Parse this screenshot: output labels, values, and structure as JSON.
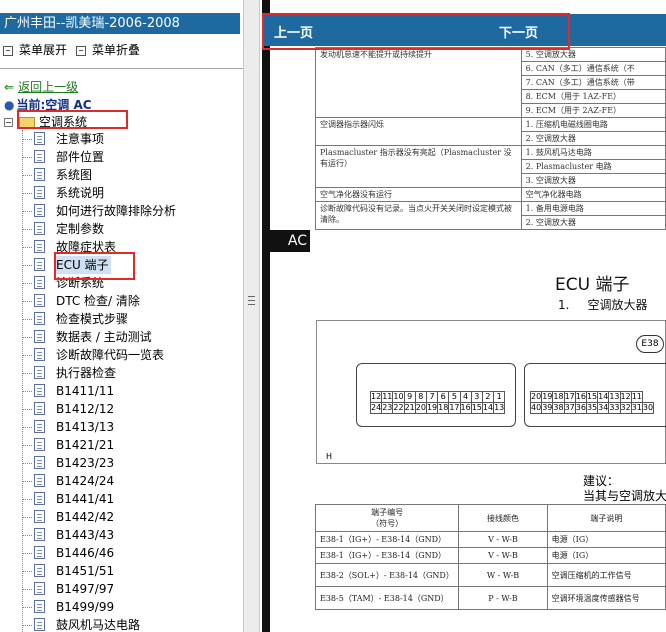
{
  "left_panel": {
    "title": "广州丰田--凯美瑞-2006-2008",
    "menu_expand": "菜单展开",
    "menu_collapse": "菜单折叠",
    "back_link": "返回上一级",
    "current_label": "当前:空调 AC",
    "folder_label": "空调系统",
    "tree_items": [
      "注意事项",
      "部件位置",
      "系统图",
      "系统说明",
      "如何进行故障排除分析",
      "定制参数",
      "故障症状表",
      "ECU 端子",
      "诊断系统",
      "DTC 检查/ 清除",
      "检查模式步骤",
      "数据表 / 主动测试",
      "诊断故障代码一览表",
      "执行器检查",
      "B1411/11",
      "B1412/12",
      "B1413/13",
      "B1421/21",
      "B1423/23",
      "B1424/24",
      "B1441/41",
      "B1442/42",
      "B1443/43",
      "B1446/46",
      "B1451/51",
      "B1497/97",
      "B1499/99",
      "鼓风机马达电路"
    ],
    "selected_index": 7
  },
  "navbar": {
    "prev": "上一页",
    "next": "下一页"
  },
  "side_tab": "AC",
  "symptom_table": [
    {
      "symptom": "发动机怠速不能提升或持续提升",
      "causes": [
        "5. 空调放大器",
        "6. CAN（多工）通信系统（不",
        "7. CAN（多工）通信系统（带",
        "8. ECM（用于 1AZ-FE）",
        "9. ECM（用于 2AZ-FE）"
      ]
    },
    {
      "symptom": "空调器指示器闪烁",
      "causes": [
        "1. 压缩机电磁线圈电路",
        "2. 空调放大器"
      ]
    },
    {
      "symptom": "Plasmacluster 指示器没有亮起（Plasmacluster 没有运行）",
      "causes": [
        "1. 鼓风机马达电路",
        "2. Plasmacluster 电路",
        "3. 空调放大器"
      ]
    },
    {
      "symptom": "空气净化器没有运行",
      "causes": [
        "空气净化器电路"
      ]
    },
    {
      "symptom": "诊断故障代码没有记录。当点火开关关闭时设定模式被清除。",
      "causes": [
        "1. 备用电源电路",
        "2. 空调放大器"
      ]
    }
  ],
  "ecu_section": {
    "title": "ECU 端子",
    "sub_number": "1.",
    "sub_title": "空调放大器",
    "connector_id": "E38",
    "h_label": "H",
    "left_pins_top": [
      "12",
      "11",
      "10",
      "9",
      "8",
      "7",
      "6",
      "5",
      "4",
      "3",
      "2",
      "1"
    ],
    "left_pins_bottom": [
      "24",
      "23",
      "22",
      "21",
      "20",
      "19",
      "18",
      "17",
      "16",
      "15",
      "14",
      "13"
    ],
    "right_pins_top": [
      "20",
      "19",
      "18",
      "17",
      "16",
      "15",
      "14",
      "13",
      "12",
      "11"
    ],
    "right_pins_bottom": [
      "40",
      "39",
      "38",
      "37",
      "36",
      "35",
      "34",
      "33",
      "32",
      "31",
      "30"
    ]
  },
  "suggestion": {
    "line1": "建议：",
    "line2": "当其与空调放大"
  },
  "terminal_table": {
    "headers": [
      "端子编号\n（符号）",
      "接线颜色",
      "端子说明"
    ],
    "rows": [
      [
        "E38-1（IG+）- E38-14（GND）",
        "V - W-B",
        "电源（IG）"
      ],
      [
        "E38-1（IG+）- E38-14（GND）",
        "V - W-B",
        "电源（IG）"
      ],
      [
        "E38-2（SOL+）- E38-14（GND）",
        "W - W-B",
        "空调压缩机的工作信号"
      ],
      [
        "E38-5（TAM）- E38-14（GND）",
        "P - W-B",
        "空调环境温度传感器信号"
      ]
    ]
  }
}
